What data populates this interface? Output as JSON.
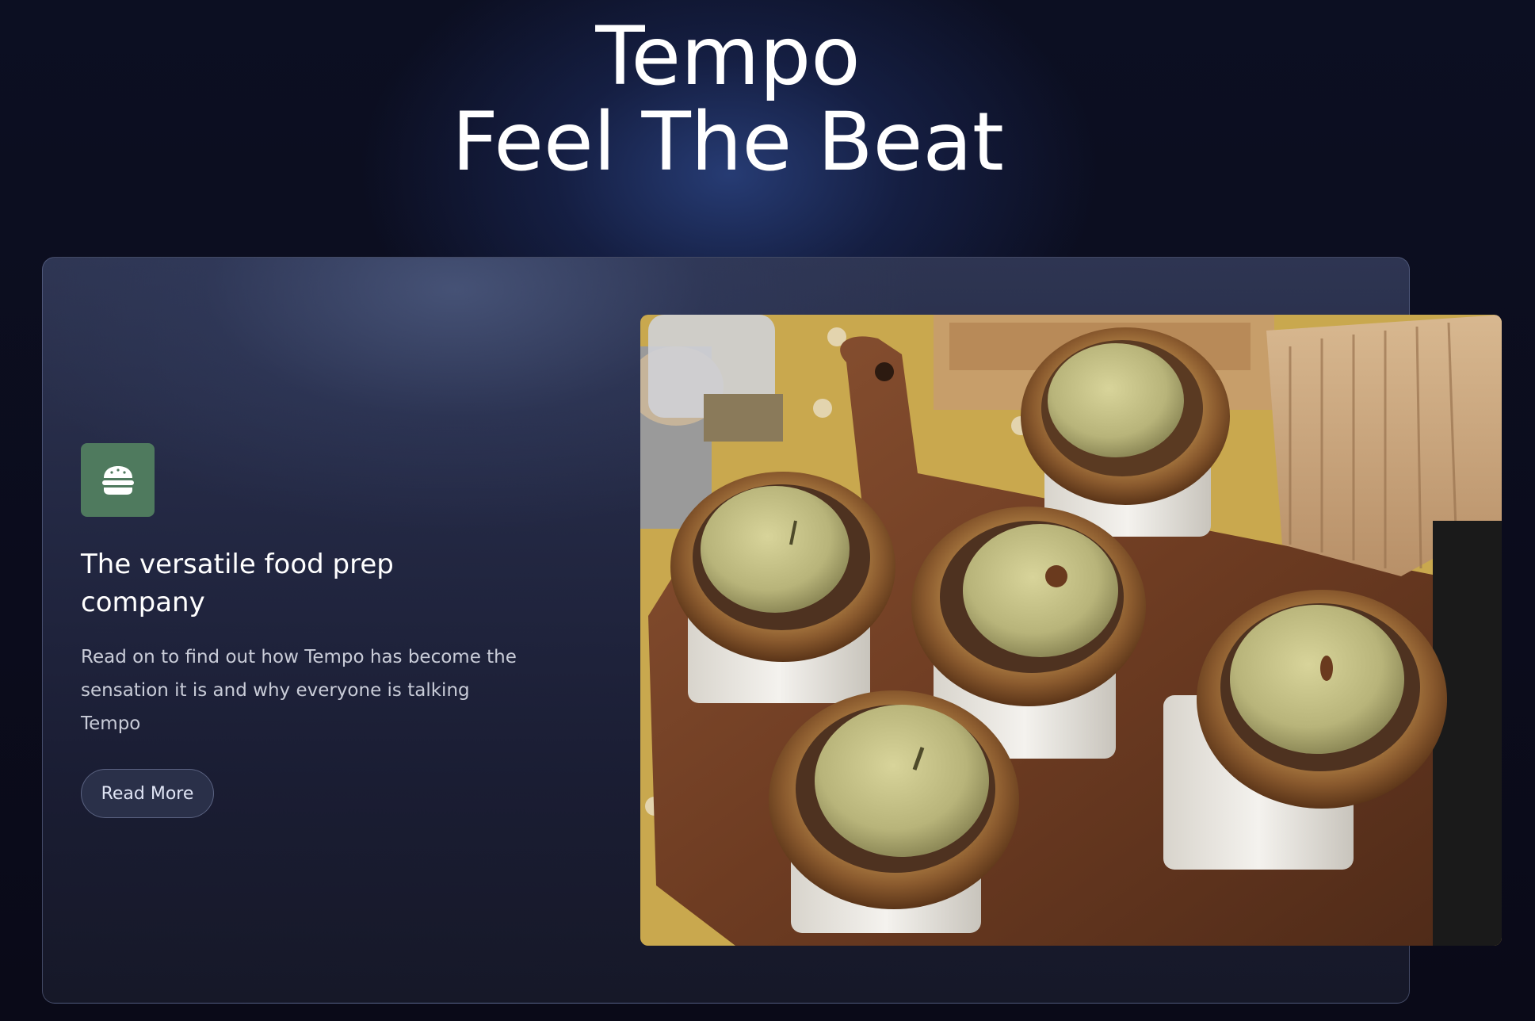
{
  "hero": {
    "line1": "Tempo",
    "line2": "Feel The Beat"
  },
  "feature": {
    "icon": "burger-icon",
    "icon_bg": "#4f7a5e",
    "title": "The versatile food prep company",
    "description": "Read on to find out how Tempo has become the sensation it is and why everyone is talking Tempo",
    "cta_label": "Read More",
    "image": "pies-photo"
  },
  "colors": {
    "background": "#0b0c1b",
    "card": "#232843",
    "accent_icon": "#4f7a5e"
  }
}
